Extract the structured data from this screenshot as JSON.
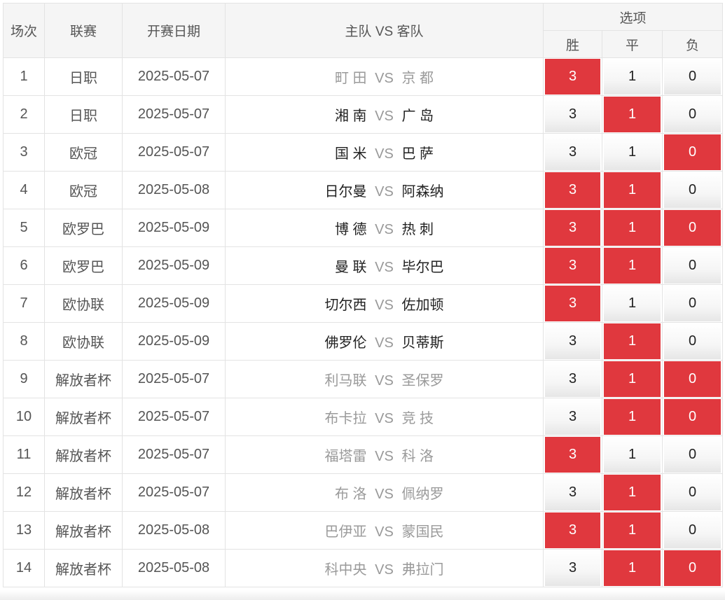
{
  "header": {
    "index": "场次",
    "league": "联赛",
    "date": "开赛日期",
    "match": "主队 VS 客队",
    "options": "选项",
    "win": "胜",
    "draw": "平",
    "lose": "负"
  },
  "vs_label": "VS",
  "colors": {
    "selected": "#e0383e",
    "muted_team": "#9a9a9a",
    "dark_team": "#222222"
  },
  "rows": [
    {
      "idx": "1",
      "league": "日职",
      "date": "2025-05-07",
      "home": "町 田",
      "away": "京 都",
      "teams_style": "muted",
      "win": "3",
      "draw": "1",
      "lose": "0",
      "sel_win": true,
      "sel_draw": false,
      "sel_lose": false
    },
    {
      "idx": "2",
      "league": "日职",
      "date": "2025-05-07",
      "home": "湘 南",
      "away": "广 岛",
      "teams_style": "dark",
      "win": "3",
      "draw": "1",
      "lose": "0",
      "sel_win": false,
      "sel_draw": true,
      "sel_lose": false
    },
    {
      "idx": "3",
      "league": "欧冠",
      "date": "2025-05-07",
      "home": "国 米",
      "away": "巴 萨",
      "teams_style": "dark",
      "win": "3",
      "draw": "1",
      "lose": "0",
      "sel_win": false,
      "sel_draw": false,
      "sel_lose": true
    },
    {
      "idx": "4",
      "league": "欧冠",
      "date": "2025-05-08",
      "home": "日尔曼",
      "away": "阿森纳",
      "teams_style": "dark",
      "win": "3",
      "draw": "1",
      "lose": "0",
      "sel_win": true,
      "sel_draw": true,
      "sel_lose": false
    },
    {
      "idx": "5",
      "league": "欧罗巴",
      "date": "2025-05-09",
      "home": "博 德",
      "away": "热 刺",
      "teams_style": "dark",
      "win": "3",
      "draw": "1",
      "lose": "0",
      "sel_win": true,
      "sel_draw": true,
      "sel_lose": true
    },
    {
      "idx": "6",
      "league": "欧罗巴",
      "date": "2025-05-09",
      "home": "曼 联",
      "away": "毕尔巴",
      "teams_style": "dark",
      "win": "3",
      "draw": "1",
      "lose": "0",
      "sel_win": true,
      "sel_draw": true,
      "sel_lose": false
    },
    {
      "idx": "7",
      "league": "欧协联",
      "date": "2025-05-09",
      "home": "切尔西",
      "away": "佐加顿",
      "teams_style": "dark",
      "win": "3",
      "draw": "1",
      "lose": "0",
      "sel_win": true,
      "sel_draw": false,
      "sel_lose": false
    },
    {
      "idx": "8",
      "league": "欧协联",
      "date": "2025-05-09",
      "home": "佛罗伦",
      "away": "贝蒂斯",
      "teams_style": "dark",
      "win": "3",
      "draw": "1",
      "lose": "0",
      "sel_win": false,
      "sel_draw": true,
      "sel_lose": false
    },
    {
      "idx": "9",
      "league": "解放者杯",
      "date": "2025-05-07",
      "home": "利马联",
      "away": "圣保罗",
      "teams_style": "muted",
      "win": "3",
      "draw": "1",
      "lose": "0",
      "sel_win": false,
      "sel_draw": true,
      "sel_lose": true
    },
    {
      "idx": "10",
      "league": "解放者杯",
      "date": "2025-05-07",
      "home": "布卡拉",
      "away": "竞 技",
      "teams_style": "muted",
      "win": "3",
      "draw": "1",
      "lose": "0",
      "sel_win": false,
      "sel_draw": true,
      "sel_lose": true
    },
    {
      "idx": "11",
      "league": "解放者杯",
      "date": "2025-05-07",
      "home": "福塔雷",
      "away": "科 洛",
      "teams_style": "muted",
      "win": "3",
      "draw": "1",
      "lose": "0",
      "sel_win": true,
      "sel_draw": false,
      "sel_lose": false
    },
    {
      "idx": "12",
      "league": "解放者杯",
      "date": "2025-05-07",
      "home": "布 洛",
      "away": "佩纳罗",
      "teams_style": "muted",
      "win": "3",
      "draw": "1",
      "lose": "0",
      "sel_win": false,
      "sel_draw": true,
      "sel_lose": false
    },
    {
      "idx": "13",
      "league": "解放者杯",
      "date": "2025-05-08",
      "home": "巴伊亚",
      "away": "蒙国民",
      "teams_style": "muted",
      "win": "3",
      "draw": "1",
      "lose": "0",
      "sel_win": true,
      "sel_draw": true,
      "sel_lose": false
    },
    {
      "idx": "14",
      "league": "解放者杯",
      "date": "2025-05-08",
      "home": "科中央",
      "away": "弗拉门",
      "teams_style": "muted",
      "win": "3",
      "draw": "1",
      "lose": "0",
      "sel_win": false,
      "sel_draw": true,
      "sel_lose": true
    }
  ]
}
